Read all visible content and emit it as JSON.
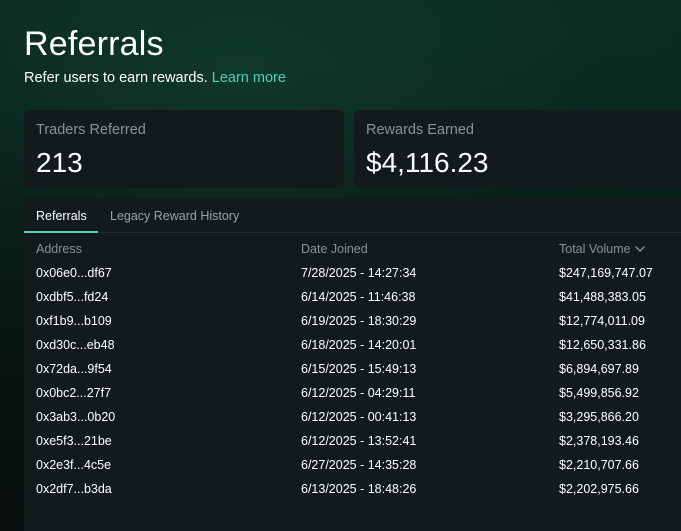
{
  "header": {
    "title": "Referrals",
    "subtitle": "Refer users to earn rewards.",
    "learn_more": "Learn more"
  },
  "stats": {
    "traders_label": "Traders Referred",
    "traders_value": "213",
    "rewards_label": "Rewards Earned",
    "rewards_value": "$4,116.23"
  },
  "tabs": [
    {
      "label": "Referrals",
      "active": true
    },
    {
      "label": "Legacy Reward History",
      "active": false
    }
  ],
  "table": {
    "columns": {
      "address": "Address",
      "date": "Date Joined",
      "volume": "Total Volume"
    },
    "sort_icon": "chevron-down-icon",
    "rows": [
      {
        "address": "0x06e0...df67",
        "date": "7/28/2025 - 14:27:34",
        "volume": "$247,169,747.07"
      },
      {
        "address": "0xdbf5...fd24",
        "date": "6/14/2025 - 11:46:38",
        "volume": "$41,488,383.05"
      },
      {
        "address": "0xf1b9...b109",
        "date": "6/19/2025 - 18:30:29",
        "volume": "$12,774,011.09"
      },
      {
        "address": "0xd30c...eb48",
        "date": "6/18/2025 - 14:20:01",
        "volume": "$12,650,331.86"
      },
      {
        "address": "0x72da...9f54",
        "date": "6/15/2025 - 15:49:13",
        "volume": "$6,894,697.89"
      },
      {
        "address": "0x0bc2...27f7",
        "date": "6/12/2025 - 04:29:11",
        "volume": "$5,499,856.92"
      },
      {
        "address": "0x3ab3...0b20",
        "date": "6/12/2025 - 00:41:13",
        "volume": "$3,295,866.20"
      },
      {
        "address": "0xe5f3...21be",
        "date": "6/12/2025 - 13:52:41",
        "volume": "$2,378,193.46"
      },
      {
        "address": "0x2e3f...4c5e",
        "date": "6/27/2025 - 14:35:28",
        "volume": "$2,210,707.66"
      },
      {
        "address": "0x2df7...b3da",
        "date": "6/13/2025 - 18:48:26",
        "volume": "$2,202,975.66"
      }
    ]
  },
  "colors": {
    "accent": "#4fd1b4",
    "card_bg": "#121a1c",
    "muted_text": "#8a9296"
  }
}
